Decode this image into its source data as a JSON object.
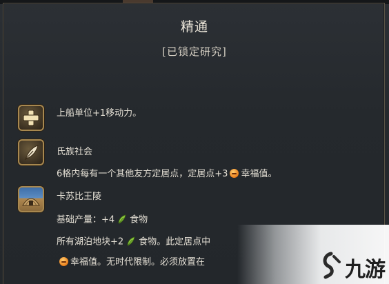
{
  "tooltip": {
    "title": "精通",
    "subtitle": "[已锁定研究]",
    "rows": {
      "move_bonus": "上船单位+1移动力。",
      "clan_title": "氏族社会",
      "clan_desc_before": "6格内每有一个其他友方定居点，定居点+3",
      "clan_desc_after": "幸福值。",
      "tomb_title": "卡苏比王陵",
      "base_yield_before": "基础产量：+4",
      "base_yield_after": "食物",
      "lake_before": "所有湖泊地块+2",
      "lake_after": "食物。此定居点中",
      "last_after": "幸福值。无时代限制。必须放置在"
    },
    "watermark": "九游",
    "colors": {
      "background": "#25292d",
      "border": "#5b5446",
      "icon_frame": "#a8884f",
      "text": "#e6e1d6",
      "happiness": "#f08a24",
      "food": "#8cc63f"
    },
    "icons": [
      "plus-icon",
      "feather-icon",
      "tomb-icon",
      "happiness-icon",
      "food-icon"
    ]
  }
}
